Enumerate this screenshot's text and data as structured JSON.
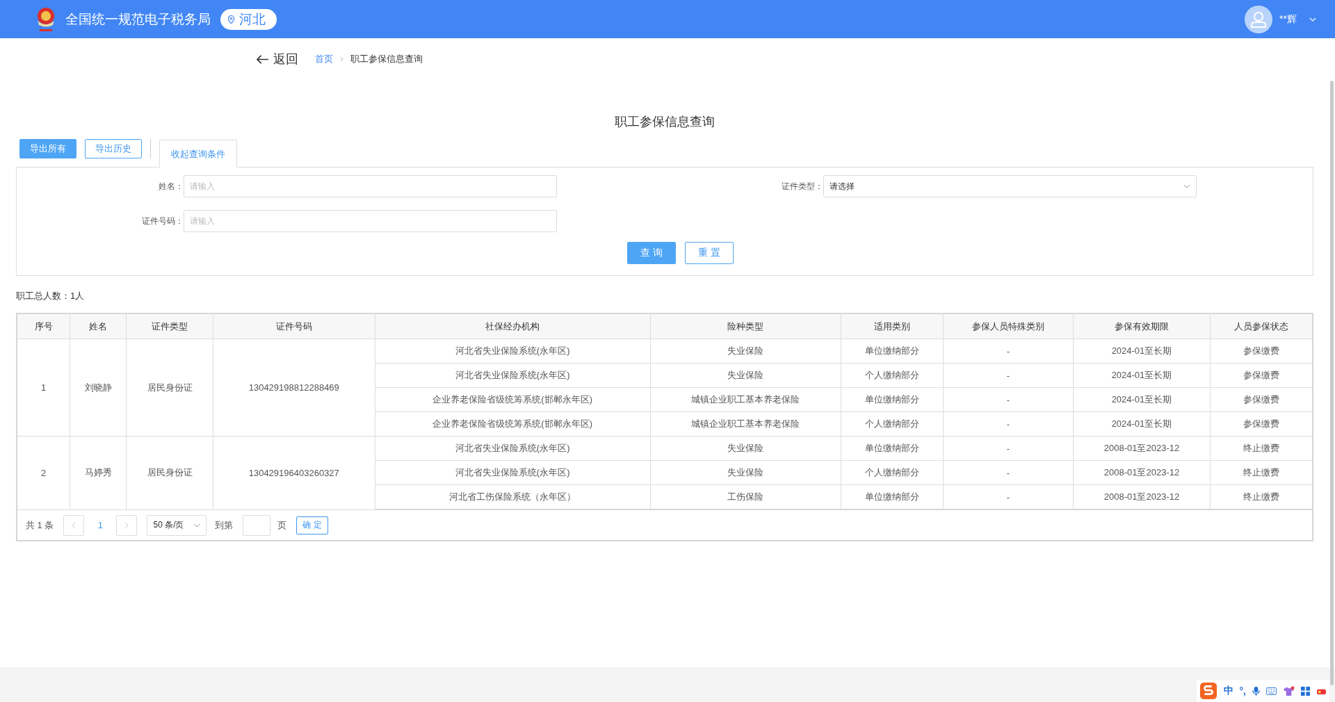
{
  "header": {
    "site_title": "全国统一规范电子税务局",
    "region": "河北",
    "user_name": "**辉"
  },
  "back": {
    "label": "返回"
  },
  "breadcrumb": [
    {
      "label": "首页",
      "kind": "link"
    },
    {
      "label": "职工参保信息查询",
      "kind": "current"
    }
  ],
  "page_title": "职工参保信息查询",
  "toolbar": {
    "buttons": [
      {
        "label": "导出所有",
        "kind": "primary"
      },
      {
        "label": "导出历史",
        "kind": "outline"
      }
    ],
    "toggle": {
      "label": "收起查询条件",
      "expanded": true
    }
  },
  "filters": [
    {
      "label": "姓名：",
      "placeholder": "请输入",
      "kind": "input"
    },
    {
      "label": "证件类型：",
      "placeholder": "请选择",
      "kind": "select"
    },
    {
      "label": "证件号码：",
      "placeholder": "请输入",
      "kind": "input"
    }
  ],
  "form_buttons": [
    {
      "label": "查 询",
      "kind": "primary"
    },
    {
      "label": "重 置",
      "kind": "outline"
    }
  ],
  "summary": "职工总人数：1人",
  "table": {
    "columns": [
      "序号",
      "姓名",
      "证件类型",
      "证件号码",
      "社保经办机构",
      "险种类型",
      "适用类别",
      "参保人员特殊类别",
      "参保有效期限",
      "人员参保状态"
    ],
    "groups": [
      {
        "seq": "1",
        "name": "刘晓静",
        "id_type": "居民身份证",
        "id_number": "130429198812288469",
        "records": [
          {
            "agency": "河北省失业保险系统(永年区)",
            "insurance_type": "失业保险",
            "category": "单位缴纳部分",
            "special_category": "-",
            "period": "2024-01至长期",
            "status": "参保缴费"
          },
          {
            "agency": "河北省失业保险系统(永年区)",
            "insurance_type": "失业保险",
            "category": "个人缴纳部分",
            "special_category": "-",
            "period": "2024-01至长期",
            "status": "参保缴费"
          },
          {
            "agency": "企业养老保险省级统筹系统(邯郸永年区)",
            "insurance_type": "城镇企业职工基本养老保险",
            "category": "单位缴纳部分",
            "special_category": "-",
            "period": "2024-01至长期",
            "status": "参保缴费"
          },
          {
            "agency": "企业养老保险省级统筹系统(邯郸永年区)",
            "insurance_type": "城镇企业职工基本养老保险",
            "category": "个人缴纳部分",
            "special_category": "-",
            "period": "2024-01至长期",
            "status": "参保缴费"
          }
        ]
      },
      {
        "seq": "2",
        "name": "马婷秀",
        "id_type": "居民身份证",
        "id_number": "130429196403260327",
        "records": [
          {
            "agency": "河北省失业保险系统(永年区)",
            "insurance_type": "失业保险",
            "category": "单位缴纳部分",
            "special_category": "-",
            "period": "2008-01至2023-12",
            "status": "终止缴费"
          },
          {
            "agency": "河北省失业保险系统(永年区)",
            "insurance_type": "失业保险",
            "category": "个人缴纳部分",
            "special_category": "-",
            "period": "2008-01至2023-12",
            "status": "终止缴费"
          },
          {
            "agency": "河北省工伤保险系统（永年区）",
            "insurance_type": "工伤保险",
            "category": "单位缴纳部分",
            "special_category": "-",
            "period": "2008-01至2023-12",
            "status": "终止缴费"
          }
        ]
      }
    ]
  },
  "pagination": {
    "total_prefix": "共",
    "total": "1",
    "total_suffix": "条",
    "pages": [
      {
        "label": "1",
        "selected": true
      }
    ],
    "page_size": "50 条/页",
    "goto_prefix": "到第",
    "goto_suffix": "页",
    "confirm": "确 定"
  },
  "ime_toolbar": {
    "mode": "中",
    "punctuation": "°,"
  }
}
